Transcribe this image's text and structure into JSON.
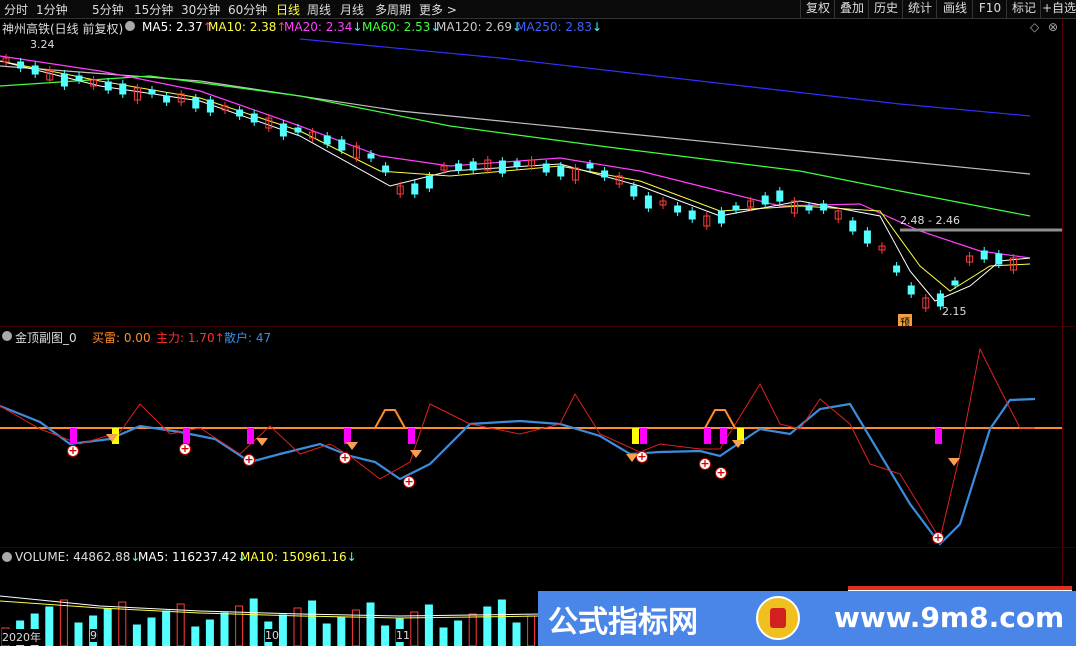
{
  "periods": [
    {
      "label": "分时",
      "active": false
    },
    {
      "label": "1分钟",
      "active": false
    },
    {
      "label": "5分钟",
      "active": false
    },
    {
      "label": "15分钟",
      "active": false
    },
    {
      "label": "30分钟",
      "active": false
    },
    {
      "label": "60分钟",
      "active": false
    },
    {
      "label": "日线",
      "active": true
    },
    {
      "label": "周线",
      "active": false
    },
    {
      "label": "月线",
      "active": false
    },
    {
      "label": "多周期",
      "active": false
    },
    {
      "label": "更多 >",
      "active": false
    }
  ],
  "tools": [
    "复权",
    "叠加",
    "历史",
    "统计",
    "画线",
    "F10",
    "标记",
    "+自选"
  ],
  "main": {
    "stock_title": "神州高铁(日线 前复权)",
    "ma": [
      {
        "label": "MA5: 2.37",
        "arrow": "↑",
        "color": "#ffffff"
      },
      {
        "label": "MA10: 2.38",
        "arrow": "↑",
        "color": "#ffff40"
      },
      {
        "label": "MA20: 2.34",
        "arrow": "↓",
        "color": "#ff40ff"
      },
      {
        "label": "MA60: 2.53",
        "arrow": "↓",
        "color": "#40ff40"
      },
      {
        "label": "MA120: 2.69",
        "arrow": "↓",
        "color": "#c0c0c0"
      },
      {
        "label": "MA250: 2.83",
        "arrow": "↓",
        "color": "#4040ff"
      }
    ],
    "high_label": "3.24",
    "range_label": "2.48 - 2.46",
    "low_label": "2.15",
    "yu_label": "预"
  },
  "sub": {
    "title": "金顶副图_0",
    "buy": "买雷: 0.00",
    "main_force": "主力: 1.70",
    "main_force_arrow": "↑",
    "retail": "散户: 47"
  },
  "volume": {
    "title": "VOLUME: 44862.88",
    "title_arrow": "↓",
    "ma5": "MA5: 116237.42",
    "ma5_arrow": "↓",
    "ma10": "MA10: 150961.16",
    "ma10_arrow": "↓"
  },
  "xaxis": [
    "2020年",
    "9",
    "10",
    "11"
  ],
  "watermark": {
    "name": "公式指标网",
    "url": "www.9m8.com"
  },
  "colors": {
    "up": "#ff3c3c",
    "down": "#54ffff",
    "ma5": "#ffffff",
    "ma10": "#ffff40",
    "ma20": "#ff40ff",
    "ma60": "#40ff40",
    "ma120": "#c0c0c0",
    "ma250": "#3030ff",
    "zero": "#ff8c28",
    "mainline": "#3c8cdc",
    "retail_line": "#e02020"
  }
}
